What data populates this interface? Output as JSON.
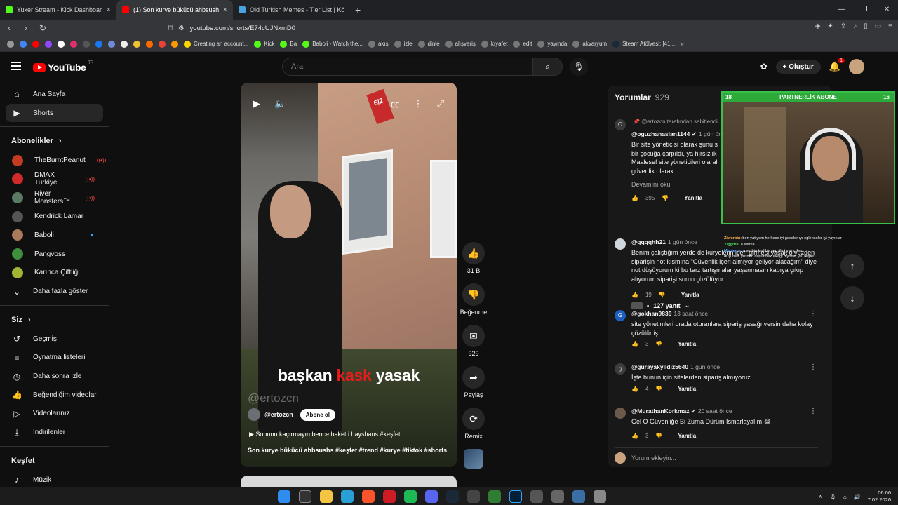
{
  "browser": {
    "tabs": [
      {
        "title": "Yuxer Stream - Kick Dashboard",
        "color": "#53fc18",
        "active": false
      },
      {
        "title": "(1) Son kurye bükücü ahbsushs",
        "color": "#ff0000",
        "active": true
      },
      {
        "title": "Old Turkish Memes - Tier List | Kör S",
        "color": "#4aa3df",
        "active": false
      }
    ],
    "new_tab": "+",
    "url": "youtube.com/shorts/E74cUJNxmD0",
    "bookmarks": [
      "Creating an account...",
      "Kick",
      "Ba",
      "Baboli - Watch the...",
      "akış",
      "izle",
      "dinle",
      "alışveriş",
      "kıyafet",
      "edit",
      "yayında",
      "akvaryum",
      "Steam Atölyesi::[41..."
    ],
    "bookmark_more": "»"
  },
  "youtube": {
    "logo_text": "YouTube",
    "logo_region": "TR",
    "search_placeholder": "Ara",
    "create_label": "Oluştur",
    "notif_count": "1"
  },
  "sidebar": {
    "main": [
      {
        "label": "Ana Sayfa",
        "icon": "home-icon",
        "glyph": "⌂"
      },
      {
        "label": "Shorts",
        "icon": "shorts-icon",
        "glyph": "▶"
      }
    ],
    "subs_heading": "Abonelikler",
    "subs": [
      {
        "label": "TheBurntPeanut",
        "color": "#c23b22",
        "status": "live"
      },
      {
        "label": "DMAX Turkiye",
        "color": "#d02a2a",
        "status": "live"
      },
      {
        "label": "River Monsters™",
        "color": "#5c7a63",
        "status": "live"
      },
      {
        "label": "Kendrick Lamar",
        "color": "#555555",
        "status": ""
      },
      {
        "label": "Baboli",
        "color": "#a97a5c",
        "status": "new"
      },
      {
        "label": "Pangvoss",
        "color": "#3e8f3e",
        "status": ""
      },
      {
        "label": "Karınca Çiftliği",
        "color": "#a3b533",
        "status": ""
      }
    ],
    "show_more": "Daha fazla göster",
    "you_heading": "Siz",
    "you": [
      {
        "label": "Geçmiş",
        "icon": "history-icon",
        "glyph": "↺"
      },
      {
        "label": "Oynatma listeleri",
        "icon": "playlists-icon",
        "glyph": "≡"
      },
      {
        "label": "Daha sonra izle",
        "icon": "watch-later-icon",
        "glyph": "◷"
      },
      {
        "label": "Beğendiğim videolar",
        "icon": "liked-videos-icon",
        "glyph": "👍"
      },
      {
        "label": "Videolarınız",
        "icon": "your-videos-icon",
        "glyph": "▷"
      },
      {
        "label": "İndirilenler",
        "icon": "downloads-icon",
        "glyph": "⤓"
      }
    ],
    "explore_heading": "Keşfet",
    "explore_first": "Müzik"
  },
  "short": {
    "caption_part1": "başkan",
    "caption_part2": "kask",
    "caption_part3": "yasak",
    "watermark": "@ertozcn",
    "sign": "6/2",
    "channel": "@ertozcn",
    "subscribe": "Abone ol",
    "desc": "Sonunu kaçırmayın bence haketti hayshaus #keşfet",
    "title": "Son kurye bükücü ahbsushs #keşfet #trend #kurye #tiktok #shorts",
    "actions": {
      "likes": "31 B",
      "dislike": "Beğenme",
      "comments": "929",
      "share": "Paylaş",
      "remix": "Remix"
    }
  },
  "comments": {
    "heading": "Yorumlar",
    "count": "929",
    "pinned_by": "@ertozcn tarafından sabitlendi",
    "read_more": "Devamını oku",
    "replies": "127 yanıt",
    "reply_label": "Yanıtla",
    "input_placeholder": "Yorum ekleyin...",
    "items": [
      {
        "user": "@oguzhanaslan1144",
        "time": "1 gün ön",
        "text": "Bir site yöneticisi olarak şunu s\nbir çocuğa çarpıldı, ya hırsızlık\nMaalesef site yöneticileri olaral\ngüvenlik olarak. ..",
        "likes": "395",
        "avatar": "O",
        "color": "#3a3a3a"
      },
      {
        "user": "@qqqqhh21",
        "time": "1 gün önce",
        "text": "Benim çalıştığım yerde de kuryelerin içeri girmesi yasak o yüzden siparişin not kısmına \"Güvenlik içeri almıyor geliyor alacağım\" diye not düşüyorum ki bu tarz tartışmalar yaşanmasın kapıya çıkıp alıyorum siparişi sorun çözülüyor",
        "likes": "19",
        "avatar": "",
        "color": "#cfd6de"
      },
      {
        "user": "@gokhan9839",
        "time": "13 saat önce",
        "text": "site yönetimleri orada oturanlara sipariş yasağı versin daha kolay çözülür iş",
        "likes": "3",
        "avatar": "G",
        "color": "#1f5fbf"
      },
      {
        "user": "@gurayakyildiz5640",
        "time": "1 gün önce",
        "text": "İşte bunun için sitelerden sipariş almıyoruz.",
        "likes": "4",
        "avatar": "g",
        "color": "#3d3d3d"
      },
      {
        "user": "@MurathanKorkmaz",
        "time": "20 saat önce",
        "text": "Gel O Güvenliğe Bi Zurna Dürüm Ismarlayalım 😂",
        "likes": "3",
        "avatar": "",
        "color": "#6b5a4a"
      }
    ]
  },
  "webcam": {
    "title": "PARTNERLİK ABONE",
    "num_left": "18",
    "num_right": "16"
  },
  "stream_chat": [
    {
      "name": "Ziworbin",
      "text": ": ben yatıyom herkese iyi geceler ıyı eglenceler iyi yayınlar",
      "cls": "nm-o"
    },
    {
      "name": "Yiggdra",
      "text": ": a serbia",
      "cls": "nm-g"
    },
    {
      "name": "Mememe",
      "text": ": a serbia kral bir sep filmi yaz çıkar",
      "cls": "nm-b"
    },
    {
      "name": "",
      "text": "düşünsel yüzden düşürmek ırkağı diyorlar ya. İkişfe!",
      "cls": "nm-g"
    }
  ],
  "taskbar": {
    "time": "06:06",
    "date": "7.02.2026"
  }
}
